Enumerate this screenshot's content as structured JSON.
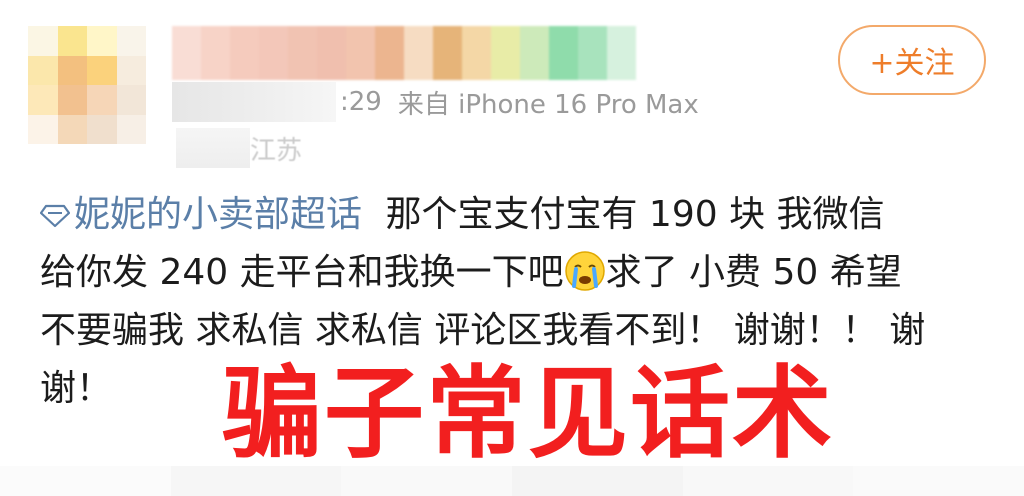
{
  "header": {
    "meta_time": ":29",
    "meta_source": "来自 iPhone 16 Pro Max",
    "location": "江苏",
    "follow_label": "+关注"
  },
  "post": {
    "topic": "妮妮的小卖部超话",
    "line1_text": "那个宝支付宝有 190 块 我微信",
    "line2_a": "给你发 240 走平台和我换一下吧",
    "line2_b": "求了 小费 50 希望",
    "line3": "不要骗我 求私信 求私信 评论区我看不到！ 谢谢！！ 谢",
    "line4": "谢！"
  },
  "overlay": {
    "text": "骗子常见话术",
    "color": "#f21f1f"
  },
  "icons": {
    "topic": "diamond-icon",
    "emoji": "crying-face-icon"
  },
  "colors": {
    "follow_accent": "#ee7d2a",
    "topic_link": "#5b7fa8"
  }
}
